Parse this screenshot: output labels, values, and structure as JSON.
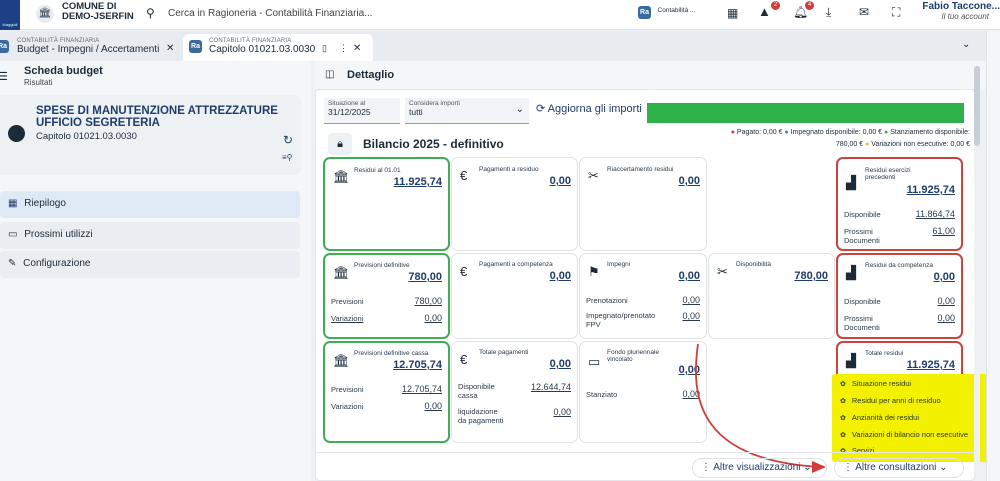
{
  "topbar": {
    "org_line1": "COMUNE DI",
    "org_line2": "DEMO-JSERFIN",
    "search_placeholder": "Cerca in Ragioneria - Contabilità Finanziaria...",
    "module_label": "Contabilità ...",
    "badge_alerts": "2",
    "badge_notifications": "4",
    "user_name": "Fabio Taccone...",
    "user_sub": "Il tuo account",
    "app_logo_text": "Maggioli"
  },
  "tabs": [
    {
      "small": "CONTABILITÀ FINANZIARIA",
      "label": "Budget - Impegni / Accertamenti"
    },
    {
      "small": "CONTABILITÀ FINANZIARIA",
      "label": "Capitolo 01021.03.0030"
    }
  ],
  "left": {
    "title": "Scheda budget",
    "subtitle": "Risultati",
    "chapter_title": "SPESE DI MANUTENZIONE ATTREZZATURE UFFICIO SEGRETERIA",
    "chapter_code": "Capitolo 01021.03.0030",
    "menu": [
      {
        "label": "Riepilogo"
      },
      {
        "label": "Prossimi utilizzi"
      },
      {
        "label": "Configurazione"
      }
    ]
  },
  "detail": {
    "header": "Dettaglio",
    "situation_label": "Situazione al",
    "situation_value": "31/12/2025",
    "consider_label": "Considera importi",
    "consider_value": "tutti",
    "refresh_label": "Aggiorna gli importi",
    "budget_title": "Bilancio 2025 - definitivo",
    "legend_line1": "Pagato: 0,00 €   ● Impegnato disponibile: 0,00 €   ● Stanziamento disponibile:",
    "legend_pagato": "Pagato: 0,00 €",
    "legend_impegnato": "Impegnato disponibile: 0,00 €",
    "legend_stanz": "Stanziamento disponibile:",
    "legend_stanz_val": "780,00 €",
    "legend_var": "Variazioni non esecutive: 0,00 €",
    "colors": {
      "pagato": "#d23b3b",
      "impegnato": "#3a7fd0",
      "stanz": "#3fae55",
      "var": "#f0b43a",
      "bar": "#2fb14a"
    }
  },
  "tiles": {
    "residui": {
      "title": "Residui al 01.01",
      "value": "11.925,74"
    },
    "pag_residuo": {
      "title": "Pagamenti a residuo",
      "value": "0,00"
    },
    "riacc": {
      "title": "Riaccertamento residui",
      "value": "0,00"
    },
    "res_prec": {
      "title": "Residui esercizi precedenti",
      "value": "11.925,74",
      "r1l": "Disponibile",
      "r1v": "11.864,74",
      "r2l": "Prossimi Documenti",
      "r2v": "61,00"
    },
    "prev_def": {
      "title": "Previsioni definitive",
      "value": "780,00",
      "r1l": "Previsioni",
      "r1v": "780,00",
      "r2l": "Variazioni",
      "r2v": "0,00"
    },
    "pag_comp": {
      "title": "Pagamenti a competenza",
      "value": "0,00"
    },
    "impegni": {
      "title": "Impegni",
      "value": "0,00",
      "r1l": "Prenotazioni",
      "r1v": "0,00",
      "r2l": "Impegnato/prenotato FPV",
      "r2v": "0,00"
    },
    "disp": {
      "title": "Disponibilità",
      "value": "780,00"
    },
    "res_comp": {
      "title": "Residui da competenza",
      "value": "0,00",
      "r1l": "Disponibile",
      "r1v": "0,00",
      "r2l": "Prossimi Documenti",
      "r2v": "0,00"
    },
    "prev_cassa": {
      "title": "Previsioni definitive cassa",
      "value": "12.705,74",
      "r1l": "Previsioni",
      "r1v": "12.705,74",
      "r2l": "Variazioni",
      "r2v": "0,00"
    },
    "tot_pag": {
      "title": "Totale pagamenti",
      "value": "0,00",
      "r1l": "Disponibile cassa",
      "r1v": "12.644,74",
      "r2l": "liquidazione da pagamenti",
      "r2v": "0,00"
    },
    "fondo": {
      "title": "Fondo pluriennale vincolato",
      "value": "0,00",
      "r1l": "Stanziato",
      "r1v": "0,00"
    },
    "tot_res": {
      "title": "Totale residui",
      "value": "11.925,74"
    }
  },
  "dropdown": [
    "Situazione residui",
    "Residui per anni di residuo",
    "Anzianità dei residui",
    "Variazioni di bilancio non esecutive",
    "Servizi"
  ],
  "footer": {
    "altre_vis": "Altre visualizzazioni",
    "altre_cons": "Altre consultazioni"
  }
}
